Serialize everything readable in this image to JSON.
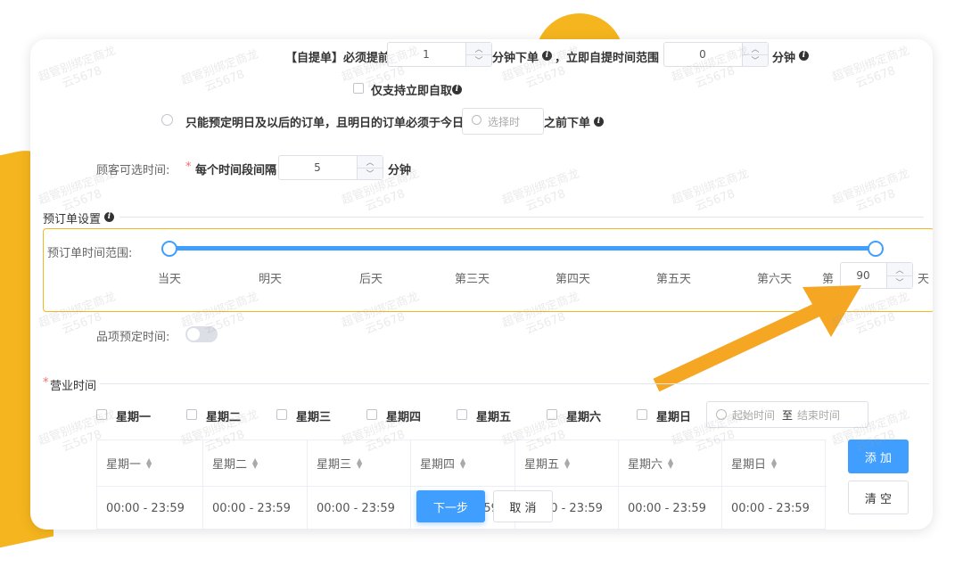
{
  "pickup": {
    "prefix": "【自提单】必须提前",
    "lead_value": "1",
    "mid_text": "分钟下单",
    "mid_text2": "，立即自提时间范围",
    "range_value": "0",
    "suffix": "分钟",
    "only_immediate": "仅支持立即自取"
  },
  "preorder_option": {
    "text": "只能预定明日及以后的订单，且明日的订单必须于今日",
    "time_placeholder": "选择时",
    "after": "之前下单"
  },
  "customer_time": {
    "label": "顾客可选时间:",
    "required_mark": "*",
    "interval_label": "每个时间段间隔",
    "interval_value": "5",
    "unit": "分钟"
  },
  "preorder_settings": {
    "title": "预订单设置",
    "range_label": "预订单时间范围:",
    "slider_ticks": [
      "当天",
      "明天",
      "后天",
      "第三天",
      "第四天",
      "第五天",
      "第六天"
    ],
    "slider_range": {
      "min_fraction": 0.0,
      "max_fraction": 1.0
    },
    "custom_prefix": "第",
    "custom_value": "90",
    "custom_suffix": "天",
    "item_label": "品项预定时间:"
  },
  "business_hours": {
    "required_mark": "*",
    "title": "营业时间",
    "weekdays": [
      "星期一",
      "星期二",
      "星期三",
      "星期四",
      "星期五",
      "星期六",
      "星期日"
    ],
    "start_placeholder": "起始时间",
    "to": "至",
    "end_placeholder": "结束时间",
    "add_button": "添 加",
    "clear_button": "清 空",
    "table_headers": [
      "星期一",
      "星期二",
      "星期三",
      "星期四",
      "星期五",
      "星期六",
      "星期日"
    ],
    "table_row": [
      "00:00 - 23:59",
      "00:00 - 23:59",
      "00:00 - 23:59",
      "00:00 - 23:59",
      "00:00 - 23:59",
      "00:00 - 23:59",
      "00:00 - 23:59"
    ]
  },
  "footer": {
    "next_button": "下一步",
    "cancel_button": "取 消"
  },
  "watermark": {
    "line1": "超管别绑定商龙",
    "line2": "云5678"
  },
  "colors": {
    "accent": "#409eff",
    "highlight_border": "#f5b51e",
    "arrow": "#f5a623",
    "background_shape": "#f5b51e"
  },
  "icons": {
    "info": "info-icon",
    "clock": "clock-icon",
    "arrow": "arrow-annotation-icon"
  }
}
